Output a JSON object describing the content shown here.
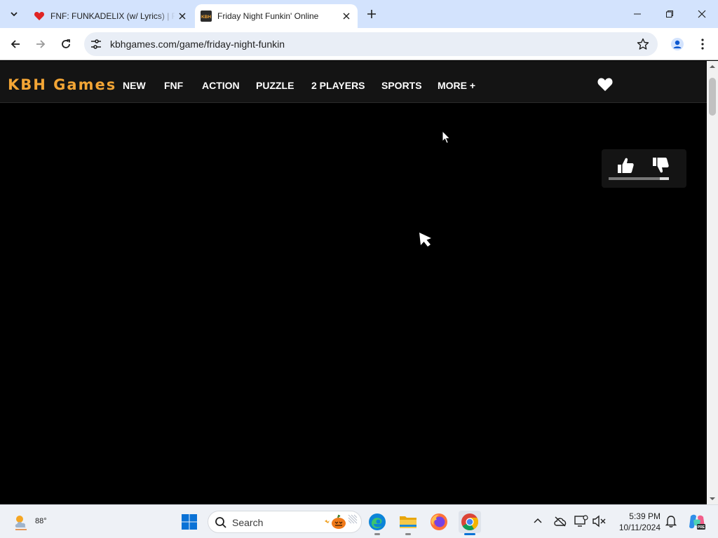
{
  "browser": {
    "tabs": [
      {
        "title": "FNF: FUNKADELIX (w/ Lyrics) | F",
        "active": false,
        "favicon": "heart-favicon"
      },
      {
        "title": "Friday Night Funkin' Online",
        "active": true,
        "favicon": "kbh-favicon"
      }
    ],
    "url": "kbhgames.com/game/friday-night-funkin"
  },
  "site": {
    "logo": "KBH Games",
    "nav": [
      "NEW",
      "FNF",
      "ACTION",
      "PUZZLE",
      "2 PLAYERS",
      "SPORTS",
      "MORE +"
    ]
  },
  "rating": {
    "like_fraction": 0.85
  },
  "taskbar": {
    "weather_temp": "88°",
    "search_placeholder": "Search",
    "time": "5:39 PM",
    "date": "10/11/2024"
  },
  "colors": {
    "logo": "#f3a535",
    "tabstrip": "#d3e3fd",
    "site_header": "#141414"
  }
}
